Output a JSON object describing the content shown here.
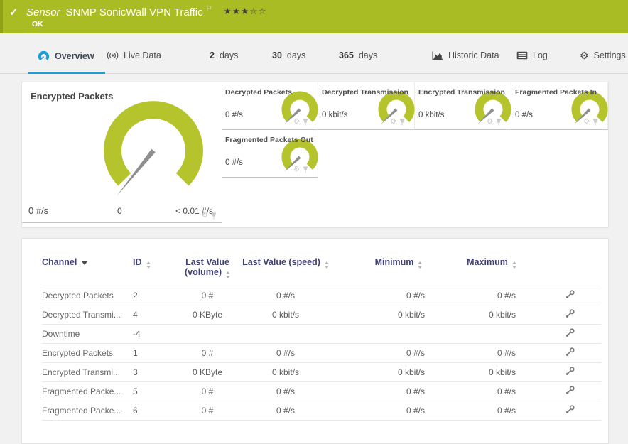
{
  "header": {
    "kind_label": "Sensor",
    "title": "SNMP SonicWall VPN Traffic",
    "status": "OK",
    "rating": "★★★☆☆"
  },
  "tabs": {
    "overview": {
      "label": "Overview"
    },
    "live_data": {
      "label": "Live Data"
    },
    "days2": {
      "num": "2",
      "unit": "days"
    },
    "days30": {
      "num": "30",
      "unit": "days"
    },
    "days365": {
      "num": "365",
      "unit": "days"
    },
    "historic": {
      "label": "Historic Data"
    },
    "log": {
      "label": "Log"
    },
    "settings": {
      "label": "Settings"
    }
  },
  "gauges": {
    "primary": {
      "title": "Encrypted Packets",
      "value": "0 #/s",
      "min_label": "0",
      "max_label": "< 0.01 #/s"
    },
    "small0": {
      "title": "Decrypted Packets",
      "value": "0 #/s"
    },
    "small1": {
      "title": "Decrypted Transmission",
      "value": "0 kbit/s"
    },
    "small2": {
      "title": "Encrypted Transmission",
      "value": "0 kbit/s"
    },
    "small3": {
      "title": "Fragmented Packets In",
      "value": "0 #/s"
    },
    "small4": {
      "title": "Fragmented Packets Out",
      "value": "0 #/s"
    }
  },
  "table": {
    "headers": {
      "channel": "Channel",
      "id": "ID",
      "volume": "Last Value (volume)",
      "speed": "Last Value (speed)",
      "min": "Minimum",
      "max": "Maximum"
    },
    "rows": [
      {
        "channel": "Decrypted Packets",
        "id": "2",
        "volume": "0 #",
        "speed": "0 #/s",
        "min": "0 #/s",
        "max": "0 #/s"
      },
      {
        "channel": "Decrypted Transmi...",
        "id": "4",
        "volume": "0 KByte",
        "speed": "0 kbit/s",
        "min": "0 kbit/s",
        "max": "0 kbit/s"
      },
      {
        "channel": "Downtime",
        "id": "-4",
        "volume": "",
        "speed": "",
        "min": "",
        "max": ""
      },
      {
        "channel": "Encrypted Packets",
        "id": "1",
        "volume": "0 #",
        "speed": "0 #/s",
        "min": "0 #/s",
        "max": "0 #/s"
      },
      {
        "channel": "Encrypted Transmi...",
        "id": "3",
        "volume": "0 KByte",
        "speed": "0 kbit/s",
        "min": "0 kbit/s",
        "max": "0 kbit/s"
      },
      {
        "channel": "Fragmented Packe...",
        "id": "5",
        "volume": "0 #",
        "speed": "0 #/s",
        "min": "0 #/s",
        "max": "0 #/s"
      },
      {
        "channel": "Fragmented Packe...",
        "id": "6",
        "volume": "0 #",
        "speed": "0 #/s",
        "min": "0 #/s",
        "max": "0 #/s"
      }
    ]
  },
  "icons": {
    "check": "✓",
    "flag": "⚐",
    "gear_glyph": "⚙"
  },
  "colors": {
    "header_green": "#a9bc23",
    "accent_blue": "#1a9ed9",
    "gauge_olive": "#b5c32c",
    "needle_gray": "#8f8f8f"
  }
}
